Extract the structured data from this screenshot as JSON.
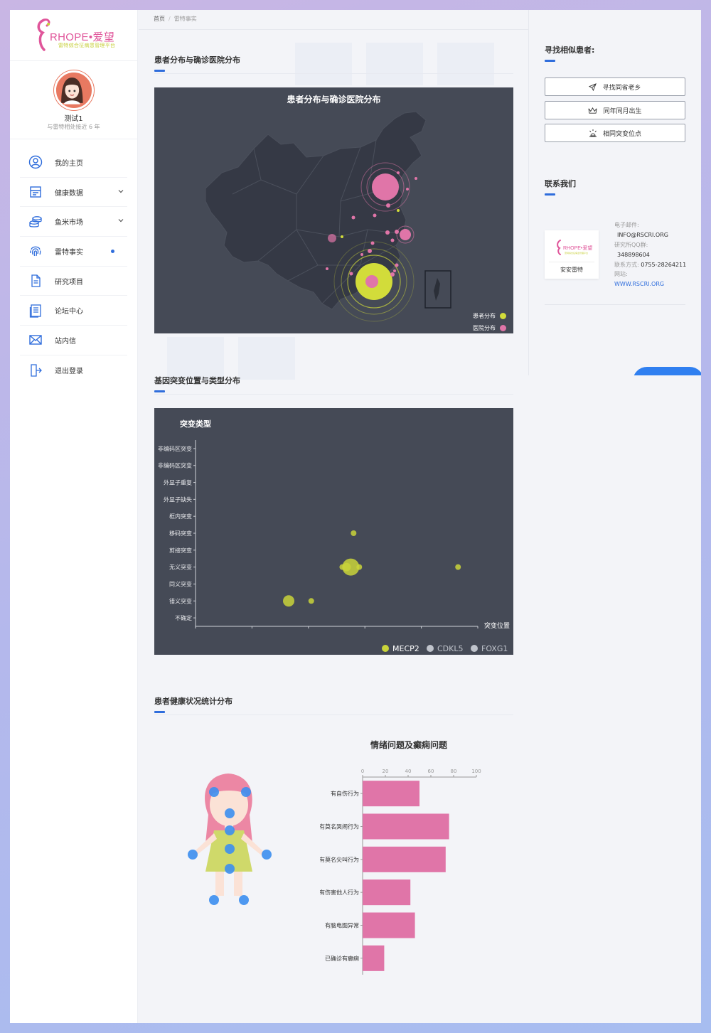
{
  "app": {
    "brand": "RHOPE•爱望",
    "brand_sub": "雷特综合征病患管理平台"
  },
  "user": {
    "name": "测试1",
    "subtitle": "与雷特相处接近 6 年"
  },
  "menu": [
    {
      "label": "我的主页",
      "icon": "user-circle-icon",
      "chevron": false,
      "dot": false
    },
    {
      "label": "健康数据",
      "icon": "health-data-icon",
      "chevron": true,
      "dot": false
    },
    {
      "label": "鱼米市场",
      "icon": "coins-icon",
      "chevron": true,
      "dot": false
    },
    {
      "label": "雷特事实",
      "icon": "fingerprint-icon",
      "chevron": false,
      "dot": true
    },
    {
      "label": "研究项目",
      "icon": "document-icon",
      "chevron": false,
      "dot": false
    },
    {
      "label": "论坛中心",
      "icon": "forum-icon",
      "chevron": false,
      "dot": false
    },
    {
      "label": "站内信",
      "icon": "mail-icon",
      "chevron": false,
      "dot": false
    },
    {
      "label": "退出登录",
      "icon": "logout-icon",
      "chevron": false,
      "dot": false
    }
  ],
  "breadcrumb": {
    "home": "首页",
    "sep": "/",
    "current": "雷特事实"
  },
  "sections": {
    "map": "患者分布与确诊医院分布",
    "mutation": "基因突变位置与类型分布",
    "health": "患者健康状况统计分布"
  },
  "map_chart": {
    "title": "患者分布与确诊医院分布",
    "legend": [
      {
        "name": "患者分布",
        "color": "#d2dc3a"
      },
      {
        "name": "医院分布",
        "color": "#e075a8"
      }
    ]
  },
  "chart_data": [
    {
      "type": "scatter",
      "title": "突变类型",
      "xlabel": "突变位置",
      "ylabel": "",
      "y_categories": [
        "不确定",
        "错义突变",
        "同义突变",
        "无义突变",
        "剪接突变",
        "移码突变",
        "框内突变",
        "外显子缺失",
        "外显子重复",
        "非编码区突变",
        "非编码区突变"
      ],
      "series": [
        {
          "name": "MECP2",
          "color": "#c9d43a"
        },
        {
          "name": "CDKL5",
          "color": "#c0c4cc"
        },
        {
          "name": "FOXG1",
          "color": "#c0c4cc"
        }
      ],
      "points": [
        {
          "x": 0.33,
          "y": 1,
          "size": 8
        },
        {
          "x": 0.41,
          "y": 1,
          "size": 4
        },
        {
          "x": 0.52,
          "y": 3,
          "size": 4
        },
        {
          "x": 0.535,
          "y": 3,
          "size": 6
        },
        {
          "x": 0.55,
          "y": 3,
          "size": 12
        },
        {
          "x": 0.58,
          "y": 3,
          "size": 4
        },
        {
          "x": 0.56,
          "y": 5,
          "size": 4
        },
        {
          "x": 0.93,
          "y": 3,
          "size": 4
        }
      ]
    },
    {
      "type": "bar",
      "title": "情绪问题及癫痫问题",
      "categories": [
        "有自伤行为",
        "有莫名哭闹行为",
        "有莫名尖叫行为",
        "有伤害他人行为",
        "有脑电图异常",
        "已确诊有癫痫"
      ],
      "values": [
        50,
        76,
        73,
        42,
        46,
        19
      ],
      "xlim": [
        0,
        100
      ],
      "xticks": [
        "0",
        "20",
        "40",
        "60",
        "80",
        "100"
      ],
      "color": "#e075a8"
    }
  ],
  "right": {
    "find_title": "寻找相似患者:",
    "buttons": [
      {
        "label": "寻找同省老乡",
        "icon": "send-icon"
      },
      {
        "label": "同年同月出生",
        "icon": "crown-icon"
      },
      {
        "label": "相同突变位点",
        "icon": "mutation-icon"
      }
    ],
    "contact_title": "联系我们",
    "card_caption": "安安雷特",
    "contact": {
      "email_label": "电子邮件:",
      "email": "INFO@RSCRI.ORG",
      "qq_label": "研究所QQ群:",
      "qq": "348898604",
      "phone_label": "联系方式:",
      "phone": "0755-28264211",
      "web_label": "网站:",
      "web": "WWW.RSCRI.ORG"
    }
  }
}
